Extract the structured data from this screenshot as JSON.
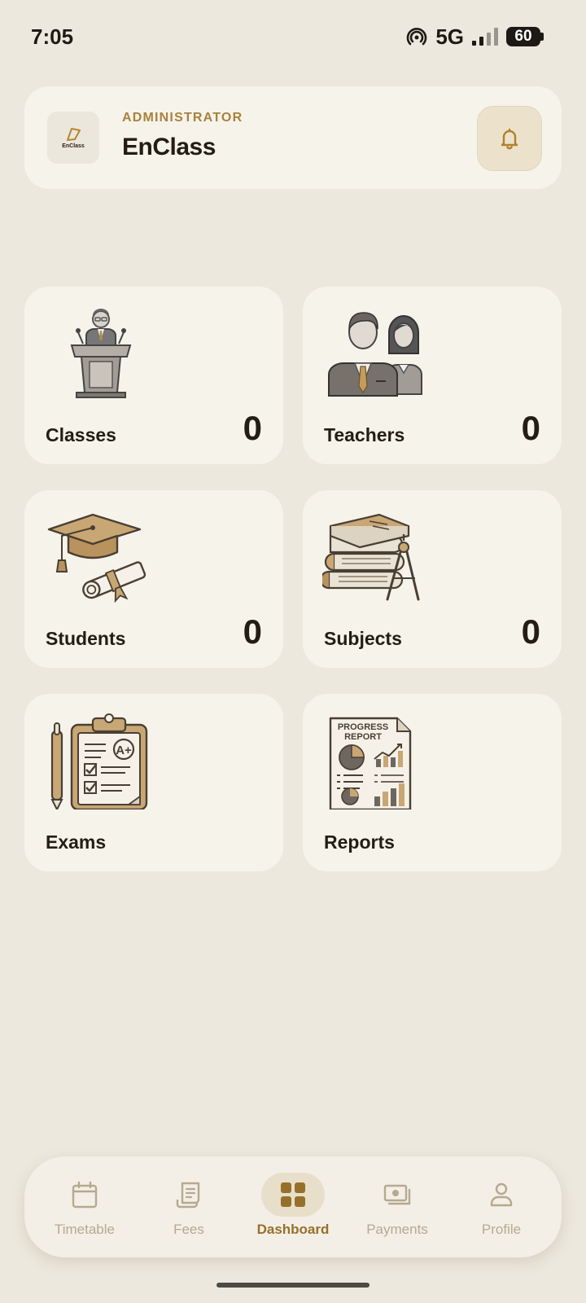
{
  "status_bar": {
    "time": "7:05",
    "network": "5G",
    "battery": "60",
    "icons": [
      "hotspot-icon",
      "signal-icon",
      "battery-icon"
    ]
  },
  "header": {
    "logo_text": "EnClass",
    "role": "ADMINISTRATOR",
    "title": "EnClass",
    "notification_icon": "bell-icon"
  },
  "cards": [
    {
      "label": "Classes",
      "count": "0",
      "icon": "lectern-icon"
    },
    {
      "label": "Teachers",
      "count": "0",
      "icon": "teachers-icon"
    },
    {
      "label": "Students",
      "count": "0",
      "icon": "graduation-cap-icon"
    },
    {
      "label": "Subjects",
      "count": "0",
      "icon": "books-icon"
    },
    {
      "label": "Exams",
      "icon": "clipboard-exam-icon"
    },
    {
      "label": "Reports",
      "icon": "progress-report-icon",
      "illustration_text": [
        "PROGRESS",
        "REPORT"
      ]
    }
  ],
  "nav": {
    "items": [
      {
        "label": "Timetable",
        "icon": "calendar-icon"
      },
      {
        "label": "Fees",
        "icon": "receipt-icon"
      },
      {
        "label": "Dashboard",
        "icon": "grid-icon",
        "active": true
      },
      {
        "label": "Payments",
        "icon": "cash-icon"
      },
      {
        "label": "Profile",
        "icon": "person-icon"
      }
    ]
  },
  "colors": {
    "background": "#ece8dd",
    "card": "#f6f3ea",
    "accent": "#a8823e",
    "text": "#231d14",
    "nav_inactive": "#b6a98f"
  }
}
